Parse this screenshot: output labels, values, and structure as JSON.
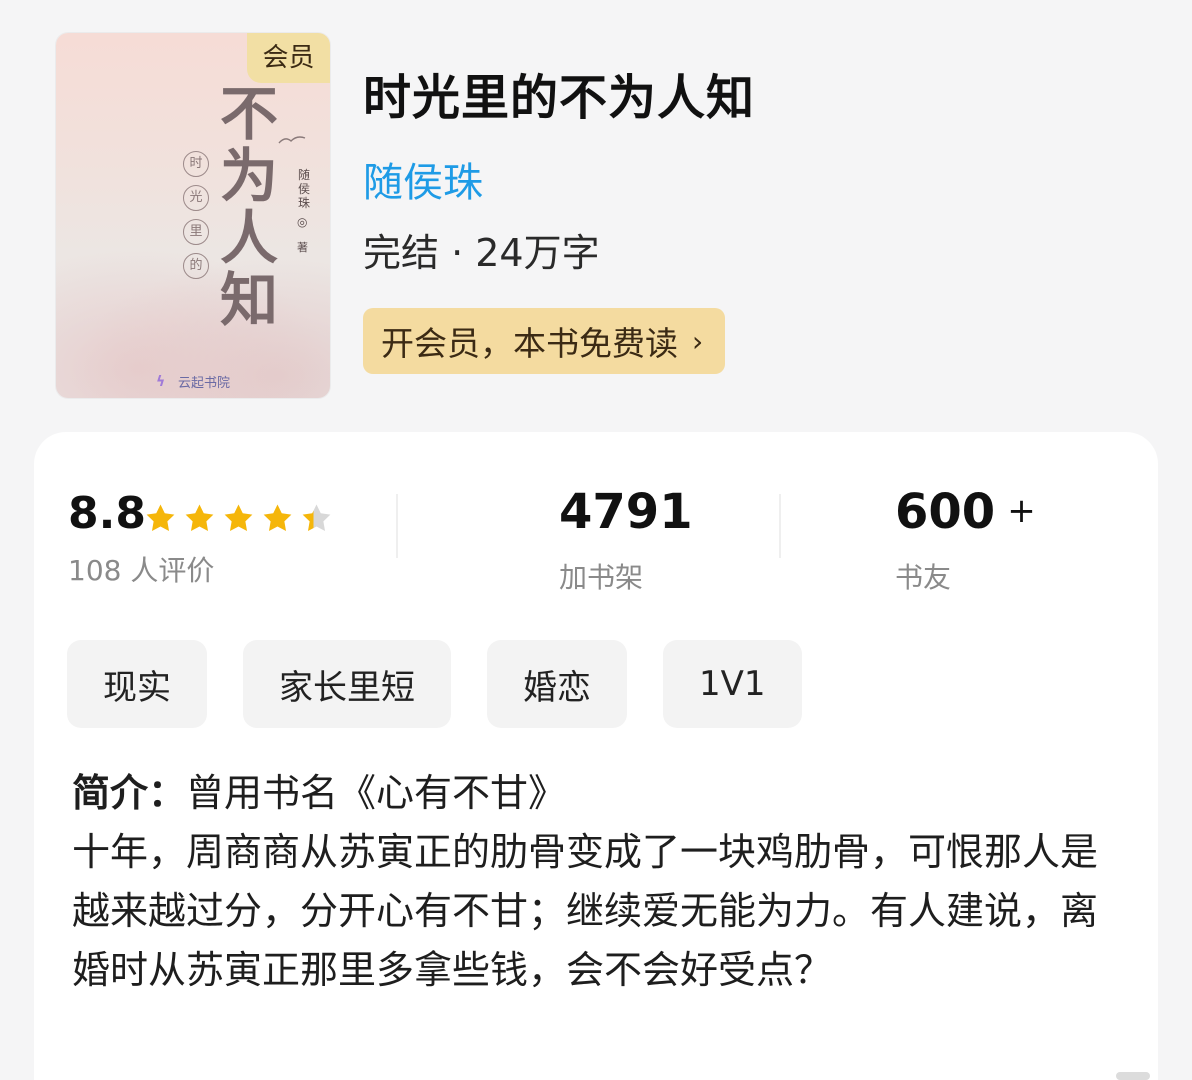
{
  "cover": {
    "badge": "会员",
    "title_main": "不为人知",
    "title_sub": [
      "时",
      "光",
      "里",
      "的"
    ],
    "author": "随侯珠",
    "author_mark": "◎",
    "author_suffix": "著",
    "publisher": "云起书院"
  },
  "book": {
    "title": "时光里的不为人知",
    "author": "随侯珠",
    "meta": "完结 · 24万字",
    "vip_button": "开会员，本书免费读",
    "vip_button_chevron": "›"
  },
  "stats": {
    "rating": "8.8",
    "stars_value": 4.4,
    "stars_max": 5,
    "rating_count": "108 人评价",
    "shelf_value": "4791",
    "shelf_label": "加书架",
    "friends_value": "600",
    "friends_plus": "+",
    "friends_label": "书友"
  },
  "tags": [
    "现实",
    "家长里短",
    "婚恋",
    "1V1"
  ],
  "intro": {
    "label": "简介：",
    "first_line": "曾用书名《心有不甘》",
    "body": "十年，周商商从苏寅正的肋骨变成了一块鸡肋骨，可恨那人是越来越过分，分开心有不甘；继续爱无能为力。有人建说，离婚时从苏寅正那里多拿些钱，会不会好受点？"
  },
  "colors": {
    "author_link": "#1e9be6",
    "vip_gold": "#f4dba0",
    "star": "#f5b60a",
    "star_empty": "#d8d8d8"
  }
}
